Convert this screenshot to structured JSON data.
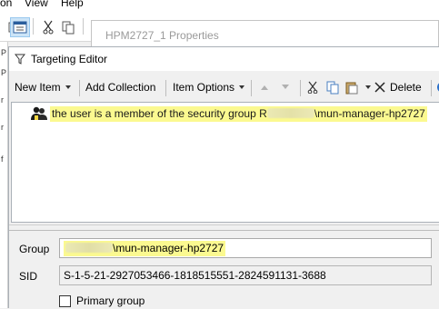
{
  "menubar": {
    "items": [
      "on",
      "View",
      "Help"
    ]
  },
  "properties_window": {
    "title": "HPM2727_1 Properties"
  },
  "targeting_editor": {
    "title": "Targeting Editor",
    "toolbar": {
      "new_item": "New Item",
      "add_collection": "Add Collection",
      "item_options": "Item Options",
      "delete": "Delete"
    },
    "tree": {
      "item_prefix": "the user is a member of the security group R",
      "item_suffix": "\\mun-manager-hp2727"
    },
    "details": {
      "group_label": "Group",
      "group_value": "\\mun-manager-hp2727",
      "sid_label": "SID",
      "sid_value": "S-1-5-21-2927053466-1818515551-2824591131-3688",
      "primary_group_label": "Primary group",
      "primary_group_checked": false
    }
  },
  "colors": {
    "highlight": "#fbf990",
    "selection_blue": "#cce4f7",
    "window_bg": "#f0f0f0"
  },
  "icons": [
    "cut-icon",
    "copy-icon",
    "paste-icon",
    "delete-icon",
    "move-up-icon",
    "move-down-icon",
    "funnel-icon",
    "user-group-icon",
    "properties-icon"
  ]
}
